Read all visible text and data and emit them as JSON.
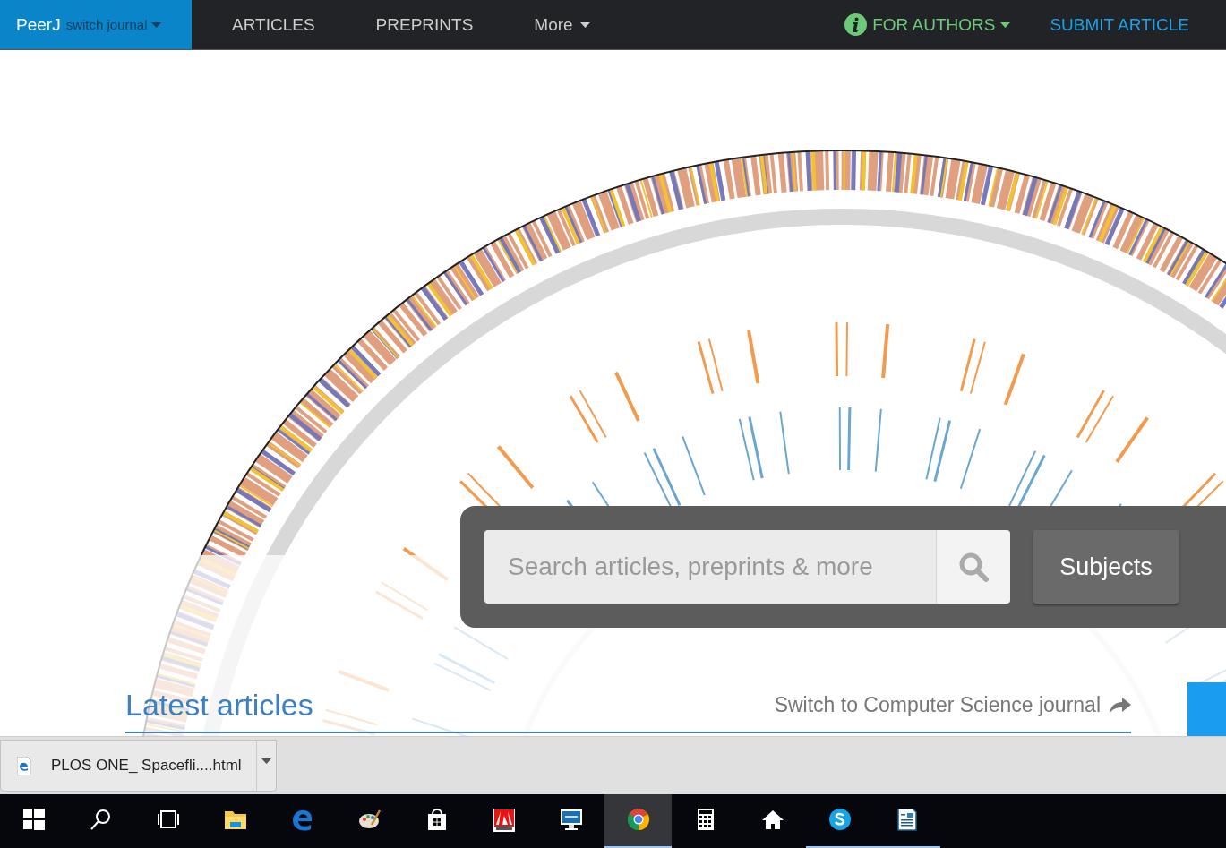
{
  "navbar": {
    "brand": "PeerJ",
    "journal_switch": "switch journal",
    "items": [
      {
        "label": "ARTICLES",
        "kind": "link"
      },
      {
        "label": "PREPRINTS",
        "kind": "link"
      },
      {
        "label": "More",
        "kind": "dropdown"
      }
    ],
    "for_authors": "FOR AUTHORS",
    "submit": "SUBMIT ARTICLE"
  },
  "hero": {
    "kind": "picture",
    "search": {
      "placeholder": "Search articles, preprints & more"
    },
    "subjects_button": "Subjects"
  },
  "latest": {
    "title": "Latest articles",
    "switch_link": "Switch to Computer Science journal"
  },
  "download_bar": {
    "file": "PLOS ONE_ Spacefli....html"
  },
  "taskbar": [
    {
      "kind": "start",
      "selected": false,
      "running": false
    },
    {
      "kind": "search",
      "selected": false,
      "running": false
    },
    {
      "kind": "taskview",
      "selected": false,
      "running": false
    },
    {
      "kind": "folder",
      "selected": false,
      "running": false
    },
    {
      "kind": "edge",
      "selected": false,
      "running": false
    },
    {
      "kind": "paint",
      "selected": false,
      "running": false
    },
    {
      "kind": "store",
      "selected": false,
      "running": false
    },
    {
      "kind": "adobe",
      "selected": false,
      "running": false
    },
    {
      "kind": "monitor",
      "selected": false,
      "running": false
    },
    {
      "kind": "chrome",
      "selected": true,
      "running": true
    },
    {
      "kind": "calculator",
      "selected": false,
      "running": false
    },
    {
      "kind": "home",
      "selected": false,
      "running": false
    },
    {
      "kind": "skype",
      "selected": false,
      "running": true
    },
    {
      "kind": "document",
      "selected": false,
      "running": true
    }
  ]
}
